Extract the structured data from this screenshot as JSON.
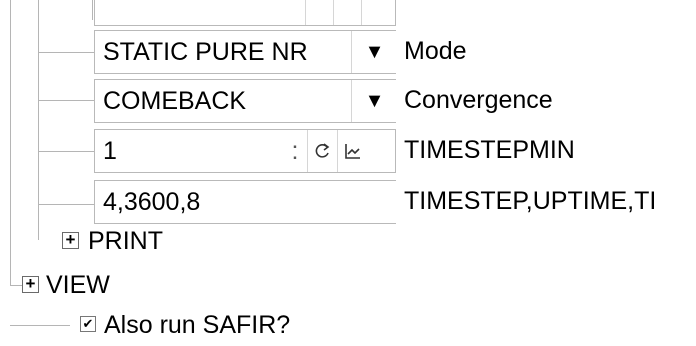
{
  "tree": {
    "rows": [
      {
        "value": "STATIC PURE NR",
        "label": "Mode"
      },
      {
        "value": "COMEBACK",
        "label": "Convergence"
      },
      {
        "value": "1",
        "label": "TIMESTEPMIN"
      },
      {
        "value": "4,3600,8",
        "label": "TIMESTEP,UPTIME,TI"
      }
    ],
    "dropdown_glyph": "▼",
    "spin_separator": ":",
    "print_node": "PRINT",
    "view_node": "VIEW",
    "expand_glyph": "+",
    "checkbox_label": "Also run SAFIR?",
    "checkbox_mark": "✔"
  }
}
